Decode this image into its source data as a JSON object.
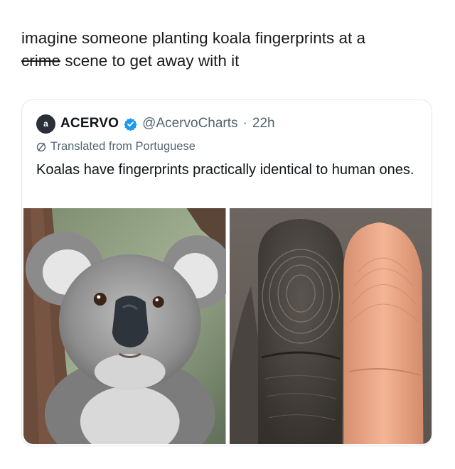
{
  "post": {
    "caption_part1": "imagine someone planting koala fingerprints at a",
    "caption_struck": "crime",
    "caption_part2": " scene to get away with it"
  },
  "quoted_tweet": {
    "avatar_text": "a",
    "account_name": "ACERVO",
    "verified_icon": "verified-badge-icon",
    "handle": "@AcervoCharts",
    "separator": "·",
    "time": "22h",
    "translated_label": "Translated from Portuguese",
    "translate_icon": "translate-icon",
    "text": "Koalas have fingerprints practically identical to human ones.",
    "images": [
      {
        "name": "koala-photo"
      },
      {
        "name": "koala-and-human-fingertip-photo"
      }
    ]
  },
  "colors": {
    "verified_blue": "#1d9bf0",
    "secondary_text": "#536471",
    "card_border": "#e3e6ea"
  }
}
